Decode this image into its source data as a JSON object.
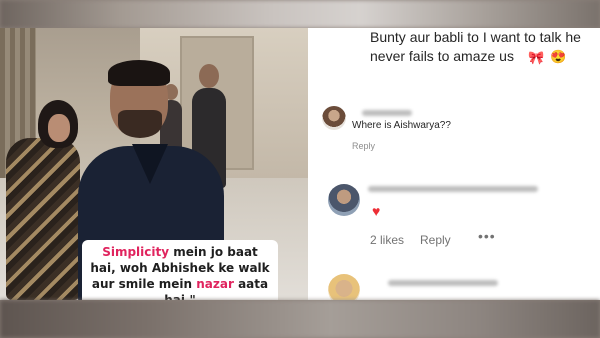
{
  "caption": {
    "highlight_1": "Simplicity",
    "part_1": " mein jo baat hai, woh Abhishek ke walk aur smile mein ",
    "highlight_2": "nazar",
    "part_2": " aata hai.\""
  },
  "comments": {
    "top_comment_text": "Bunty aur babli to I want to talk he never fails to amaze us",
    "top_comment_emojis": [
      "🎀",
      "😍"
    ],
    "comment_1": {
      "text": "Where is Aishwarya??",
      "reply_label": "Reply"
    },
    "comment_2": {
      "reaction": "♥",
      "likes": "2 likes",
      "reply_label": "Reply",
      "more": "•••"
    }
  },
  "colors": {
    "highlight": "#e0245e",
    "heart": "#ed2d35",
    "meta_gray": "#737373"
  }
}
